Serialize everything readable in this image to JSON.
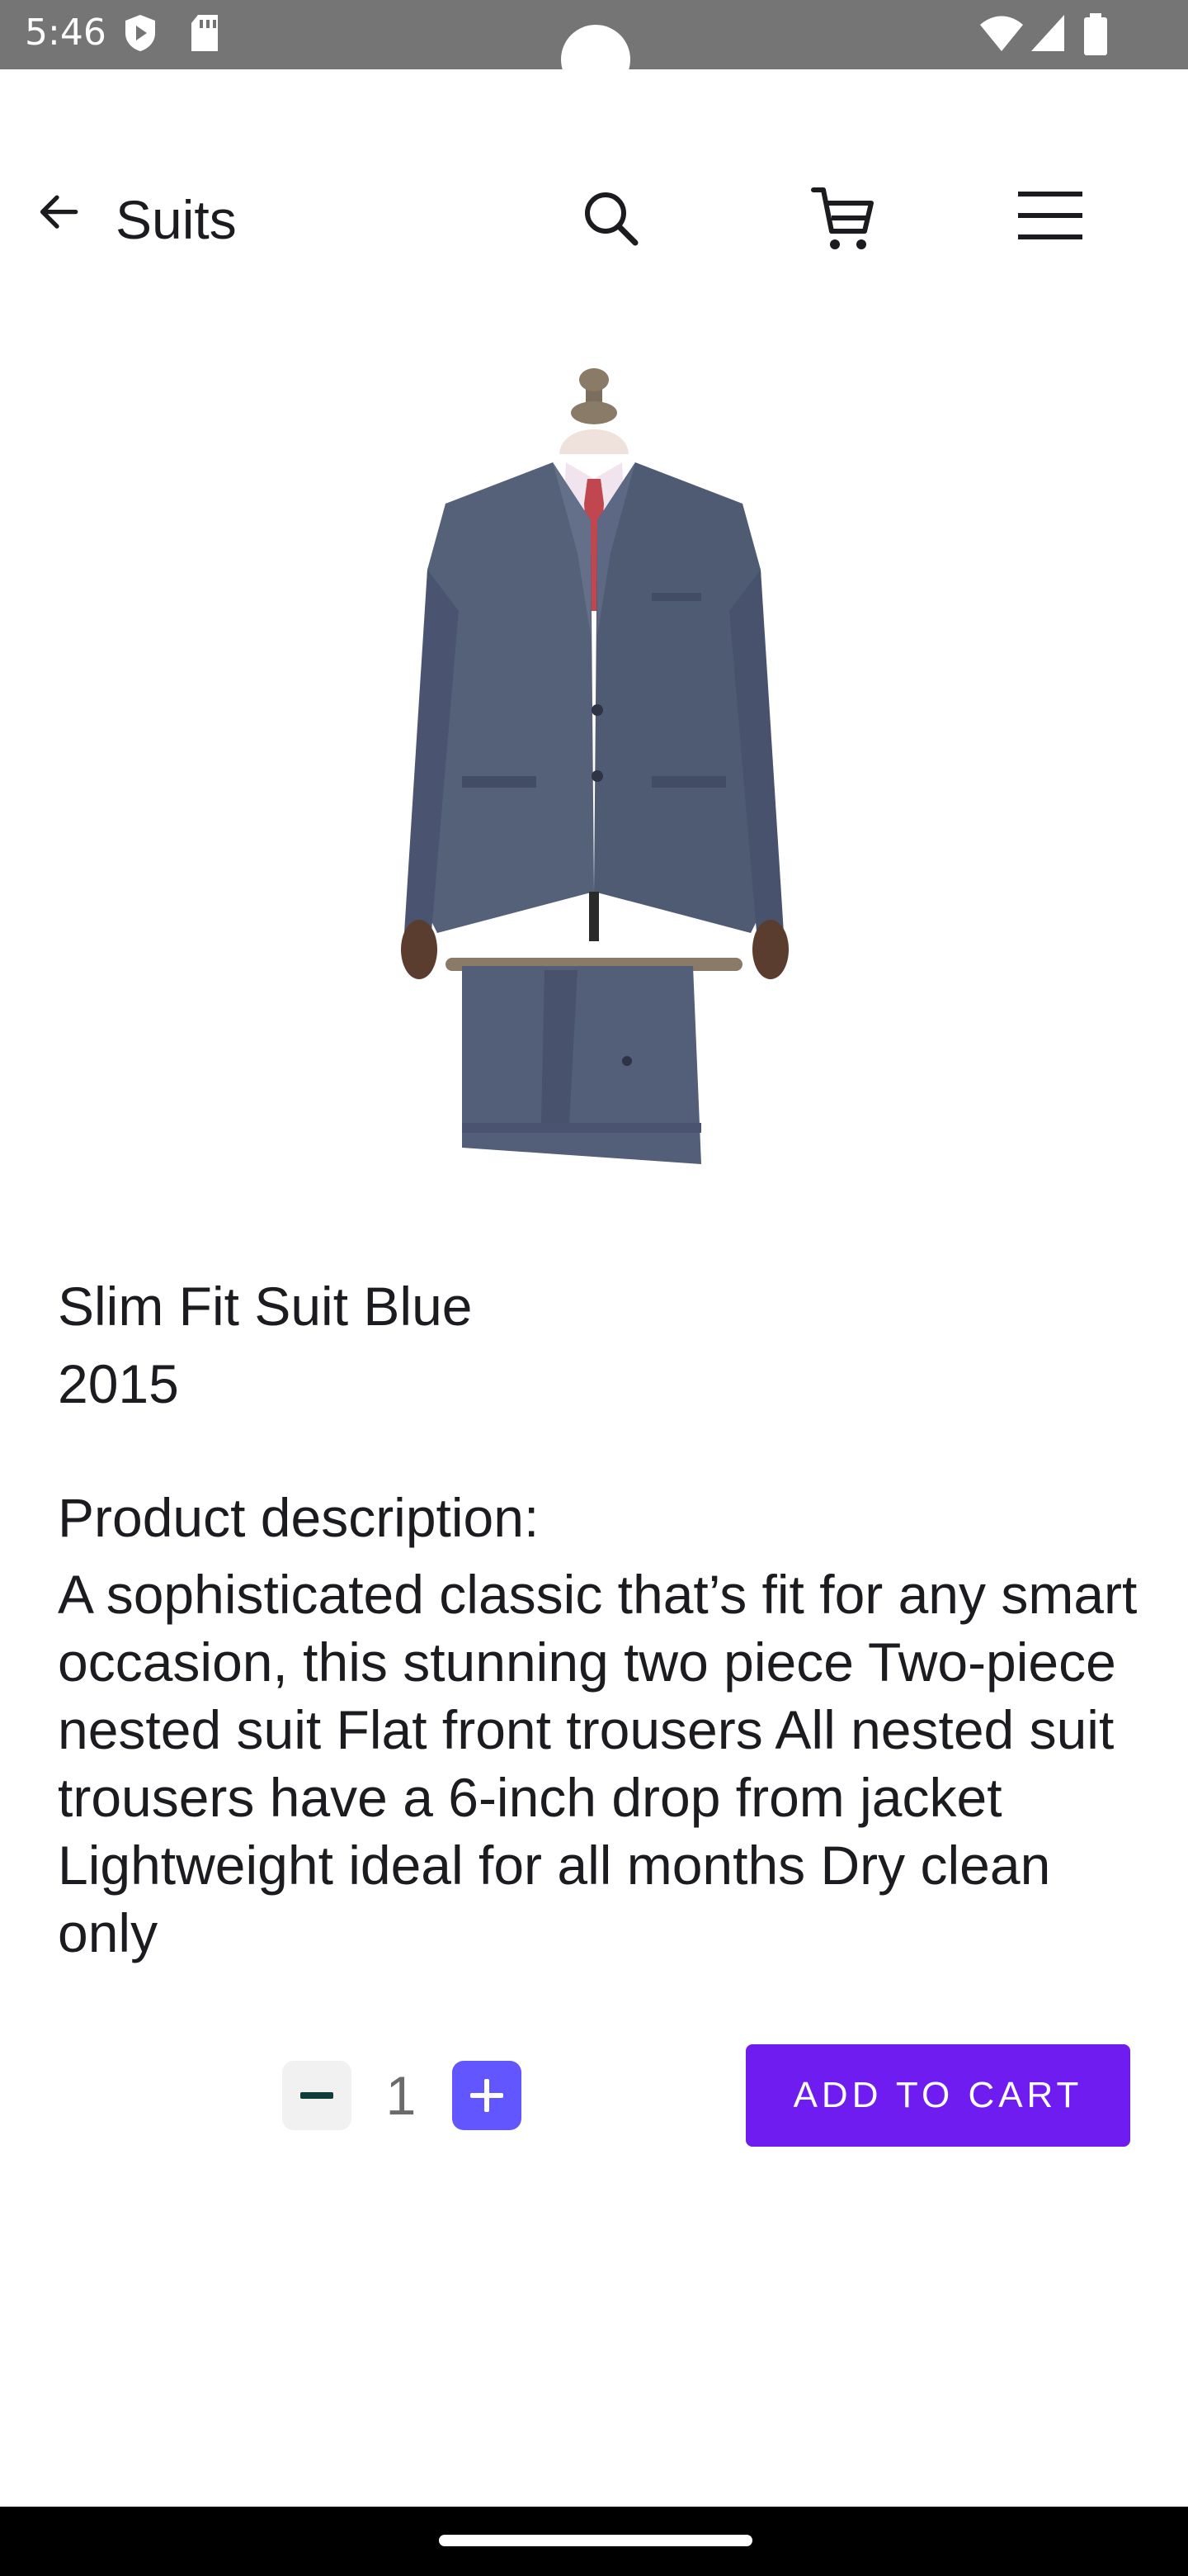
{
  "status_bar": {
    "time": "5:46",
    "icons": [
      "shield-play-icon",
      "sd-card-icon",
      "wifi-icon",
      "signal-icon",
      "battery-icon"
    ]
  },
  "app_bar": {
    "title": "Suits",
    "actions": [
      "back-arrow-icon",
      "search-icon",
      "cart-icon",
      "menu-icon"
    ]
  },
  "product": {
    "name": "Slim Fit Suit Blue",
    "year": "2015",
    "description_heading": "Product description:",
    "description": "A sophisticated classic that’s fit for any smart occasion, this stunning two piece Two-piece nested suit Flat front trousers All nested suit trousers have a 6-inch drop from jacket Lightweight ideal for all months Dry clean only",
    "image_icon": "suit-on-mannequin"
  },
  "purchase": {
    "quantity": "1",
    "add_to_cart_label": "ADD TO CART"
  },
  "colors": {
    "status_bar": "#757575",
    "plus_button": "#6156ff",
    "add_to_cart": "#6f1cf1",
    "minus_button": "#f1f1f1"
  }
}
